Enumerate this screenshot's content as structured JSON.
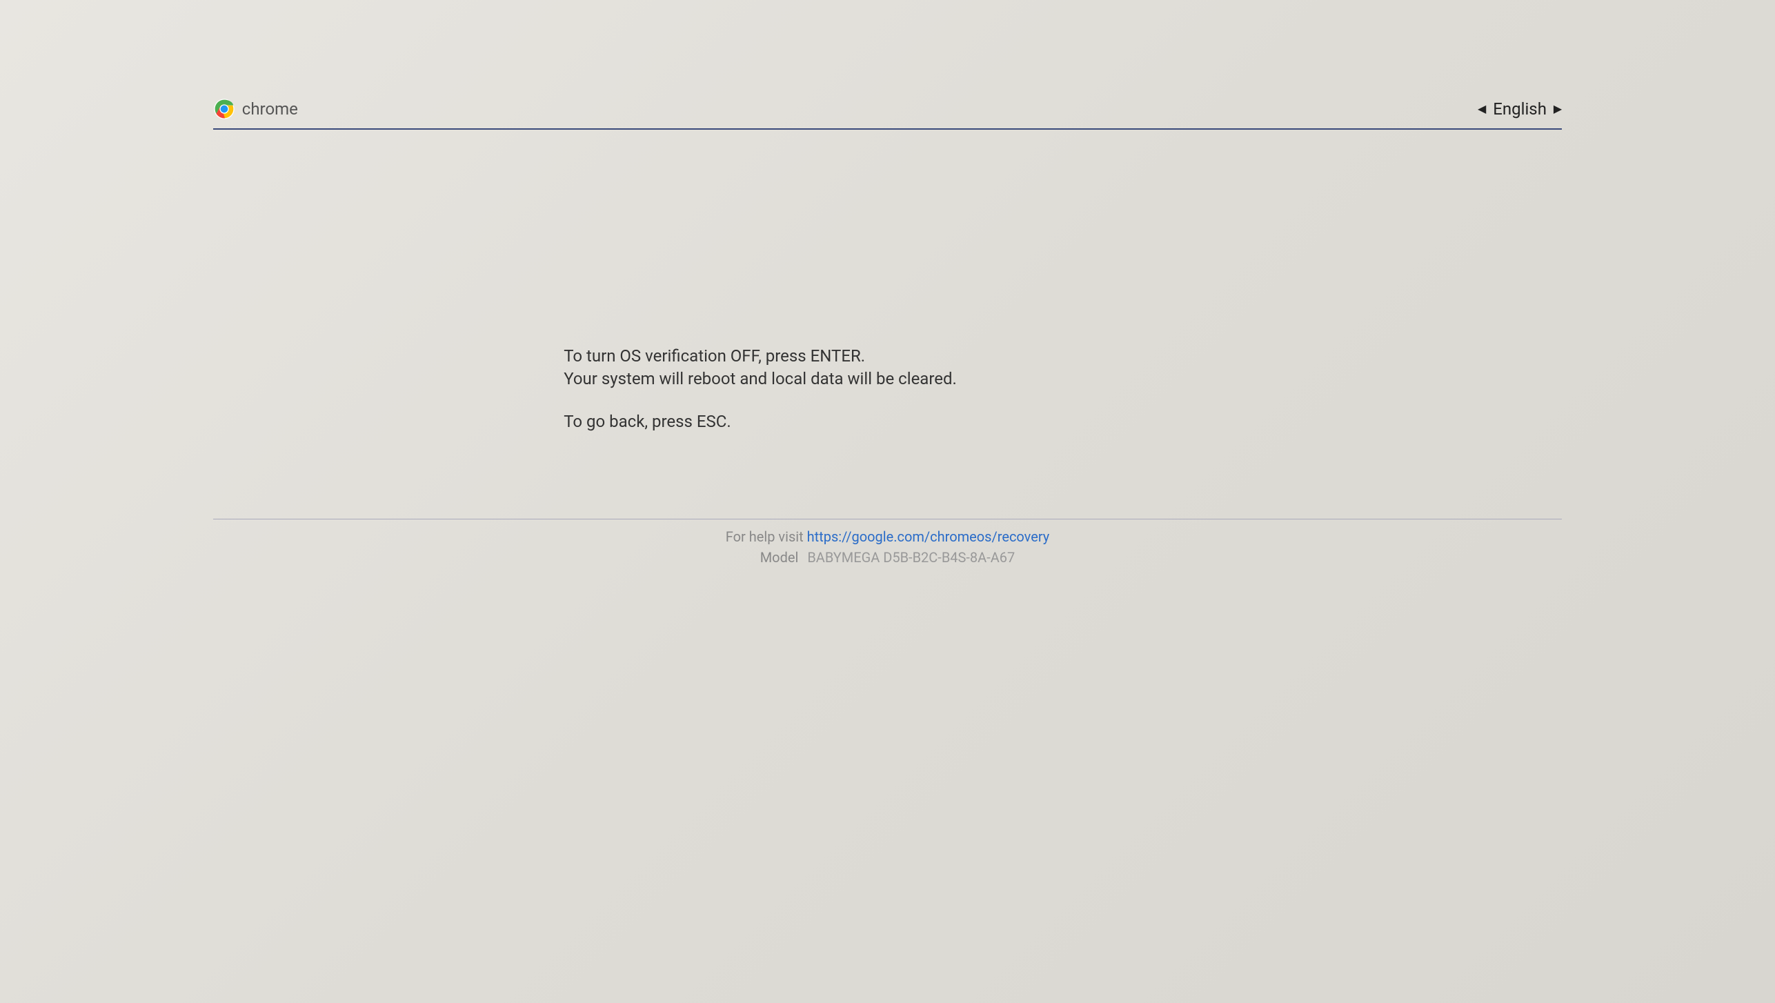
{
  "header": {
    "brand_text": "chrome",
    "language": "English"
  },
  "message": {
    "line1": "To turn OS verification OFF, press ENTER.",
    "line2": "Your system will reboot and local data will be cleared.",
    "line3": "To go back, press ESC."
  },
  "footer": {
    "help_label": "For help visit",
    "help_url": "https://google.com/chromeos/recovery",
    "model_label": "Model",
    "model_value": "BABYMEGA D5B-B2C-B4S-8A-A67"
  }
}
